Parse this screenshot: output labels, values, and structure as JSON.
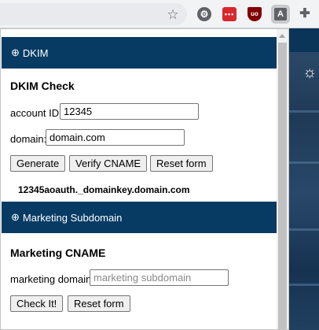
{
  "browser": {
    "toolbar_icons": [
      "bookmark-star-icon",
      "gear-extension-icon",
      "lastpass-extension-icon",
      "ublock-extension-icon",
      "active-extension-icon",
      "puzzle-extensions-icon"
    ],
    "star_glyph": "☆",
    "ext_red_glyph": "•••",
    "ext_ub_glyph": "uo",
    "ext_a_glyph": "A",
    "puzzle_glyph": "✚",
    "gear_glyph": "⚙"
  },
  "dkim": {
    "header": "DKIM",
    "header_icon": "⊕",
    "title": "DKIM Check",
    "account_label": "account ID:",
    "account_value": "12345",
    "domain_label": "domain:",
    "domain_value": "domain.com",
    "buttons": {
      "generate": "Generate",
      "verify": "Verify CNAME",
      "reset": "Reset form"
    },
    "result": "12345aoauth._domainkey.domain.com"
  },
  "marketing": {
    "header": "Marketing Subdomain",
    "header_icon": "⊕",
    "title": "Marketing CNAME",
    "domain_label": "marketing domain:",
    "domain_placeholder": "marketing subdomain",
    "buttons": {
      "check": "Check It!",
      "reset": "Reset form"
    }
  },
  "background": {
    "sun_glyph": "☼"
  },
  "colors": {
    "header_bg": "#073b64",
    "header_text": "#ffffff"
  }
}
